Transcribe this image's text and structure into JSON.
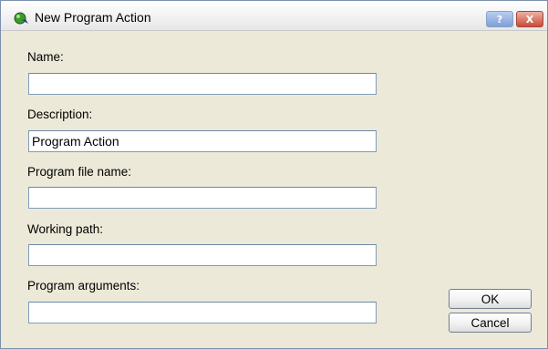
{
  "window": {
    "title": "New Program Action",
    "help_label": "?",
    "close_label": "X"
  },
  "form": {
    "name_label": "Name:",
    "name_value": "",
    "description_label": "Description:",
    "description_value": "Program Action",
    "program_file_label": "Program file name:",
    "program_file_value": "",
    "working_path_label": "Working path:",
    "working_path_value": "",
    "program_arguments_label": "Program arguments:",
    "program_arguments_value": ""
  },
  "buttons": {
    "ok_label": "OK",
    "cancel_label": "Cancel"
  },
  "colors": {
    "dialog_background": "#ece9d8",
    "field_border": "#7f9db9",
    "close_button": "#cd4a35",
    "help_button": "#7f9fd8"
  },
  "icons": {
    "app_icon": "green-orb-with-arrow-icon"
  }
}
